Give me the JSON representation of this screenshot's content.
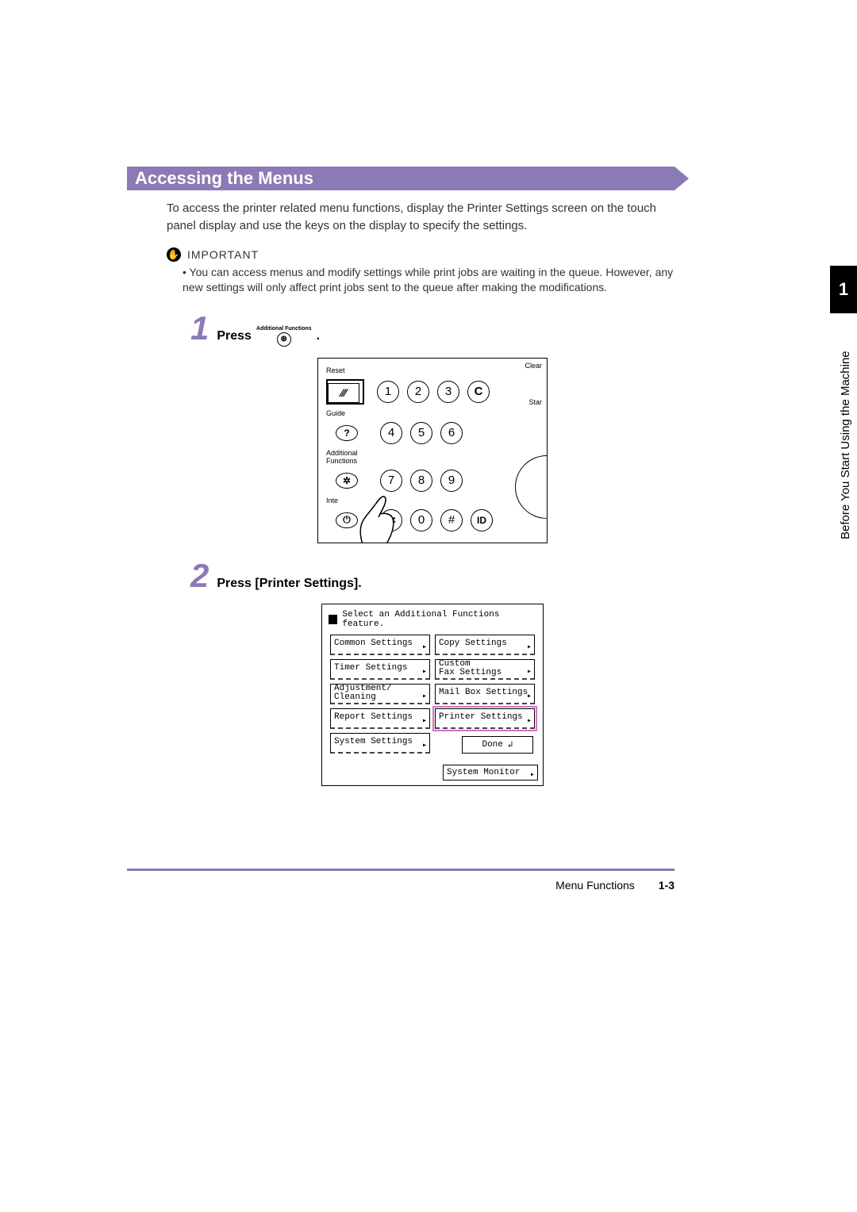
{
  "banner": {
    "title": "Accessing the Menus"
  },
  "intro": "To access the printer related menu functions, display the Printer Settings screen on the touch panel display and use the keys on the display to specify the settings.",
  "important": {
    "label": "IMPORTANT",
    "items": [
      "You can access menus and modify settings while print jobs are waiting in the queue. However, any new settings will only affect print jobs sent to the queue after making the modifications."
    ]
  },
  "steps": {
    "s1": {
      "num": "1",
      "prefix": "Press",
      "keylabel": "Additional Functions",
      "suffix": "."
    },
    "s2": {
      "num": "2",
      "text": "Press [Printer Settings]."
    }
  },
  "keypad": {
    "labels": {
      "reset": "Reset",
      "guide": "Guide",
      "addfn": "Additional Functions",
      "inte": "Inte",
      "clear": "Clear",
      "start": "Star"
    },
    "icons": {
      "slashes": "⁄⁄⁄",
      "question": "?",
      "gear": "✲",
      "power": "⏻",
      "star": "✱",
      "c": "C",
      "hash": "#",
      "id": "ID"
    },
    "nums": {
      "n1": "1",
      "n2": "2",
      "n3": "3",
      "n4": "4",
      "n5": "5",
      "n6": "6",
      "n7": "7",
      "n8": "8",
      "n9": "9",
      "n0": "0"
    }
  },
  "touchscreen": {
    "header": "Select an Additional Functions feature.",
    "buttons": {
      "common": "Common Settings",
      "timer": "Timer Settings",
      "adj": "Adjustment/\nCleaning",
      "report": "Report Settings",
      "system": "System Settings",
      "copy": "Copy Settings",
      "custom": "Custom\nFax Settings",
      "mailbox": "Mail Box Settings",
      "printer": "Printer Settings"
    },
    "done": "Done",
    "sysmon": "System Monitor"
  },
  "sidebar": {
    "chapter": "1",
    "text": "Before You Start Using the Machine"
  },
  "footer": {
    "section": "Menu Functions",
    "page": "1-3"
  }
}
